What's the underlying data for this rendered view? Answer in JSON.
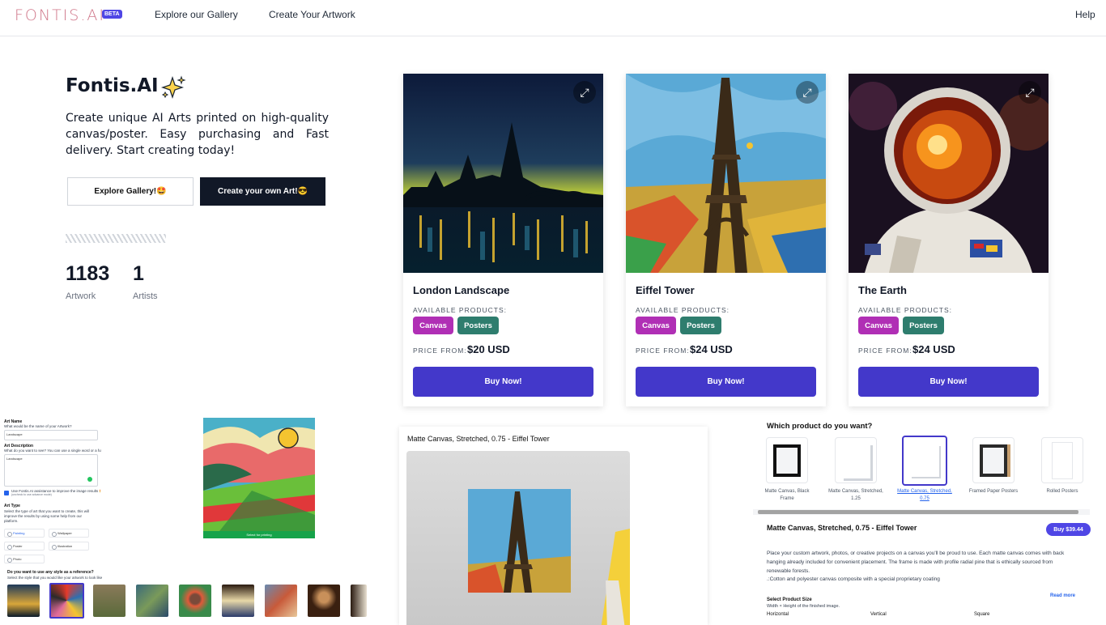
{
  "nav": {
    "logo": "FONTIS.AI",
    "beta": "BETA",
    "links": [
      "Explore our Gallery",
      "Create Your Artwork"
    ],
    "help": "Help"
  },
  "hero": {
    "title": "Fontis.AI",
    "description": "Create unique AI Arts printed on high-quality canvas/poster. Easy purchasing and Fast delivery. Start creating today!",
    "explore_btn": "Explore Gallery!🤩",
    "create_btn": "Create your own Art!😎"
  },
  "stats": [
    {
      "value": "1183",
      "label": "Artwork"
    },
    {
      "value": "1",
      "label": "Artists"
    }
  ],
  "cards": [
    {
      "name": "London Landscape",
      "available": "AVAILABLE PRODUCTS:",
      "tags": [
        "Canvas",
        "Posters"
      ],
      "price_from": "PRICE FROM:",
      "price": "$20 USD",
      "buy": "Buy Now!"
    },
    {
      "name": "Eiffel Tower",
      "available": "AVAILABLE PRODUCTS:",
      "tags": [
        "Canvas",
        "Posters"
      ],
      "price_from": "PRICE FROM:",
      "price": "$24 USD",
      "buy": "Buy Now!"
    },
    {
      "name": "The Earth",
      "available": "AVAILABLE PRODUCTS:",
      "tags": [
        "Canvas",
        "Posters"
      ],
      "price_from": "PRICE FROM:",
      "price": "$24 USD",
      "buy": "Buy Now!"
    }
  ],
  "colors": {
    "tag_canvas": "#b02fb5",
    "tag_posters": "#2e7d6e",
    "buy": "#4338ca",
    "dark": "#111827",
    "accent": "#4f46e5"
  },
  "form": {
    "art_name": "Art Name",
    "art_name_help": "What would be the name of your Artwork?",
    "art_name_value": "Landscape",
    "art_desc": "Art Description",
    "art_desc_help": "What do you want to see? You can use a single word or a full sentence",
    "art_desc_value": "Landscape",
    "assist": "Use Fontis.AI assistance to improve the image results 🤩",
    "assist_sub": "(uncheck to use advance mode)",
    "art_type": "Art Type",
    "art_type_help": "Select the type of art that you want to create, this will improve the results by using some help from our platform.",
    "types": [
      "Painting",
      "Wallpaper",
      "Poster",
      "Illustration",
      "Photo"
    ],
    "style_q": "Do you want to use any style as a reference?",
    "style_help": "Select the style that you would like your artwork to look like",
    "select_printing": "Select for printing"
  },
  "mockup": {
    "title": "Matte Canvas, Stretched, 0.75 - Eiffel Tower"
  },
  "product": {
    "question": "Which product do you want?",
    "options": [
      "Matte Canvas, Black Frame",
      "Matte Canvas, Stretched, 1.25",
      "Matte Canvas, Stretched, 0.75",
      "Framed Paper Posters",
      "Rolled Posters"
    ],
    "selected_title": "Matte Canvas, Stretched, 0.75 - Eiffel Tower",
    "buy": "Buy $39.44",
    "desc": "Place your custom artwork, photos, or creative projects on a canvas you'll be proud to use. Each matte canvas comes with back hanging already included for convenient placement. The frame is made with profile radial pine that is ethically sourced from renewable forests.",
    "desc2": ".:Cotton and polyester canvas composite with a special proprietary coating",
    "read_more": "Read more",
    "size_title": "Select Product Size",
    "size_help": "Width × Height of the finished image.",
    "orientations": [
      "Horizontal",
      "Vertical",
      "Square"
    ]
  }
}
